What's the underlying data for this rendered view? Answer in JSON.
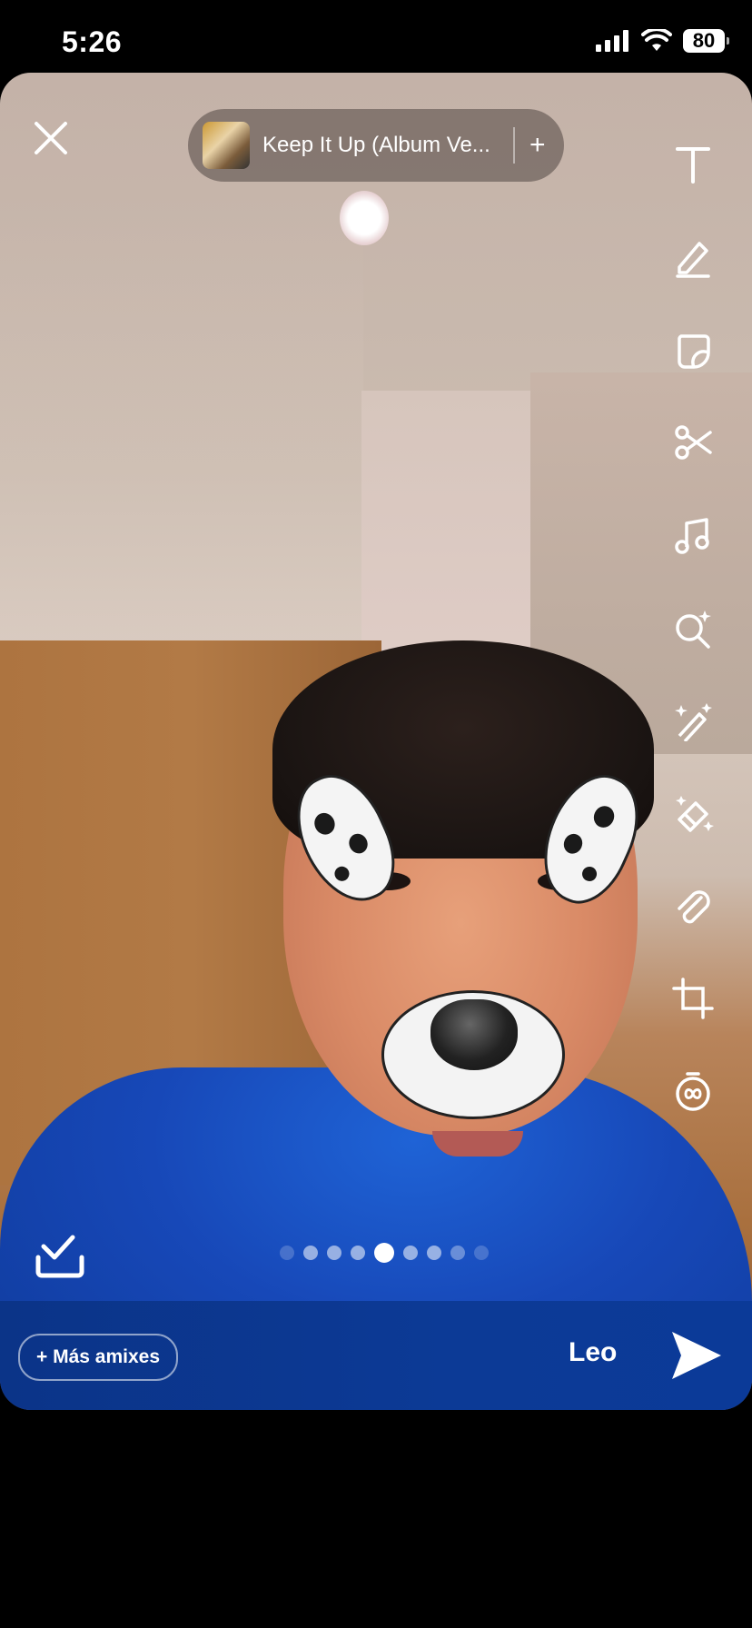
{
  "status_bar": {
    "time": "5:26",
    "battery": "80"
  },
  "music": {
    "title": "Keep It Up (Album Ve...",
    "add_symbol": "+"
  },
  "toolbar": {
    "tools": [
      "text-icon",
      "pencil-icon",
      "sticker-icon",
      "scissors-icon",
      "music-icon",
      "lens-search-icon",
      "magic-wand-icon",
      "eraser-icon",
      "paperclip-icon",
      "crop-icon",
      "timer-icon"
    ]
  },
  "pagination": {
    "count": 9,
    "active_index": 4
  },
  "bottom": {
    "more_label": "+ Más amixes",
    "recipient": "Leo"
  },
  "colors": {
    "accent": "#0c3a96",
    "chip": "#504642"
  }
}
